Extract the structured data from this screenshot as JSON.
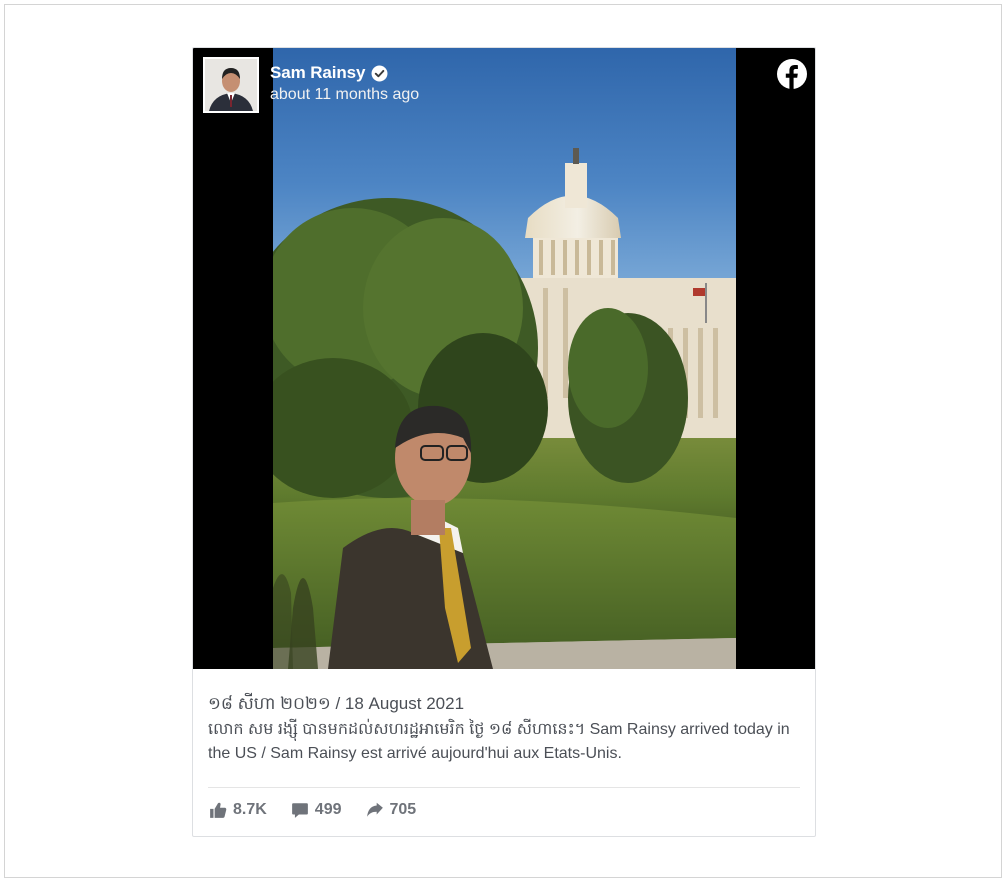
{
  "post": {
    "author": "Sam Rainsy",
    "time": "about 11 months ago",
    "caption_date": "១៨ សីហា ២០២១ / 18 August 2021",
    "caption_text": "លោក សម រង្ស៊ី បានមកដល់សហរដ្ឋអាមេរិក ថ្ងៃ ១៨ សីហានេះ។ Sam Rainsy arrived today in the US / Sam Rainsy est arrivé aujourd'hui aux Etats-Unis."
  },
  "stats": {
    "likes": "8.7K",
    "comments": "499",
    "shares": "705"
  },
  "icons": {
    "verified": "verified-check-icon",
    "facebook": "facebook-logo-icon",
    "like": "thumbs-up-icon",
    "comment": "comment-bubble-icon",
    "share": "share-arrow-icon"
  },
  "colors": {
    "text": "#4b4f56",
    "stats": "#6f737a",
    "border": "#dddfe2"
  }
}
